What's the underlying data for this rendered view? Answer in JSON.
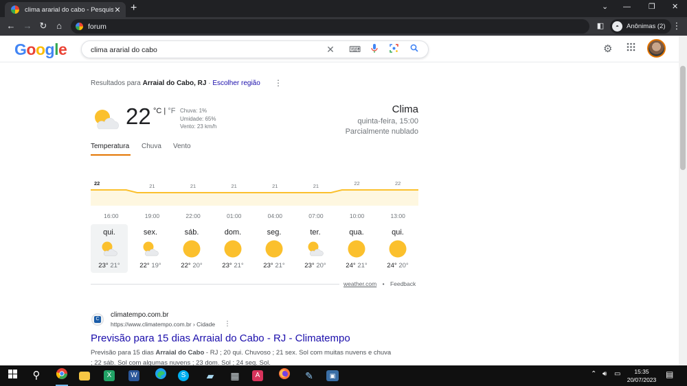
{
  "browser": {
    "tab_title": "clima ararial do cabo - Pesquisa G",
    "tab_close": "✕",
    "new_tab": "+",
    "url": "forum",
    "incognito_label": "Anônimas (2)",
    "win_controls": [
      "⌄",
      "—",
      "❐",
      "✕"
    ]
  },
  "google": {
    "logo": [
      "G",
      "o",
      "o",
      "g",
      "l",
      "e"
    ],
    "logo_colors": [
      "#4285f4",
      "#ea4335",
      "#fbbc05",
      "#4285f4",
      "#34a853",
      "#ea4335"
    ],
    "query": "clima ararial do cabo"
  },
  "results_for": {
    "prefix": "Resultados para",
    "place": "Arraial do Cabo, RJ",
    "separator": " · ",
    "change": "Escolher região"
  },
  "weather": {
    "temp": "22",
    "unit_c": "°C",
    "unit_sep": " | ",
    "unit_f": "°F",
    "chuva": "Chuva: 1%",
    "umidade": "Umidade: 65%",
    "vento": "Vento: 23 km/h",
    "title": "Clima",
    "day_time": "quinta-feira, 15:00",
    "condition": "Parcialmente nublado",
    "tabs": [
      "Temperatura",
      "Chuva",
      "Vento"
    ],
    "chart_data": {
      "type": "area",
      "x": [
        "16:00",
        "19:00",
        "22:00",
        "01:00",
        "04:00",
        "07:00",
        "10:00",
        "13:00"
      ],
      "values": [
        22,
        21,
        21,
        21,
        21,
        21,
        22,
        22
      ],
      "color": "#fbc02d",
      "fill": "#fef7e0"
    },
    "days": [
      {
        "name": "qui.",
        "icon": "partly-cloudy-icon",
        "hi": "23°",
        "lo": "21°"
      },
      {
        "name": "sex.",
        "icon": "partly-cloudy-icon",
        "hi": "22°",
        "lo": "19°"
      },
      {
        "name": "sáb.",
        "icon": "sun-icon",
        "hi": "22°",
        "lo": "20°"
      },
      {
        "name": "dom.",
        "icon": "sun-icon",
        "hi": "23°",
        "lo": "21°"
      },
      {
        "name": "seg.",
        "icon": "sun-icon",
        "hi": "23°",
        "lo": "21°"
      },
      {
        "name": "ter.",
        "icon": "partly-cloudy-icon",
        "hi": "23°",
        "lo": "20°"
      },
      {
        "name": "qua.",
        "icon": "sun-icon",
        "hi": "24°",
        "lo": "21°"
      },
      {
        "name": "qui.",
        "icon": "sun-icon",
        "hi": "24°",
        "lo": "20°"
      }
    ],
    "source": "weather.com",
    "bullet": "•",
    "feedback": "Feedback"
  },
  "result": {
    "site": "climatempo.com.br",
    "url": "https://www.climatempo.com.br › Cidade",
    "title": "Previsão para 15 dias Arraial do Cabo - RJ - Climatempo",
    "snippet_a": "Previsão para 15 dias ",
    "snippet_bold": "Arraial do Cabo",
    "snippet_b": " - RJ ; 20 qui. Chuvoso ; 21 sex. Sol com muitas nuvens e chuva ; 22 sáb. Sol com algumas nuvens ; 23 dom. Sol ; 24 seg. Sol."
  },
  "taskbar": {
    "time": "15:35",
    "date": "20/07/2023"
  }
}
